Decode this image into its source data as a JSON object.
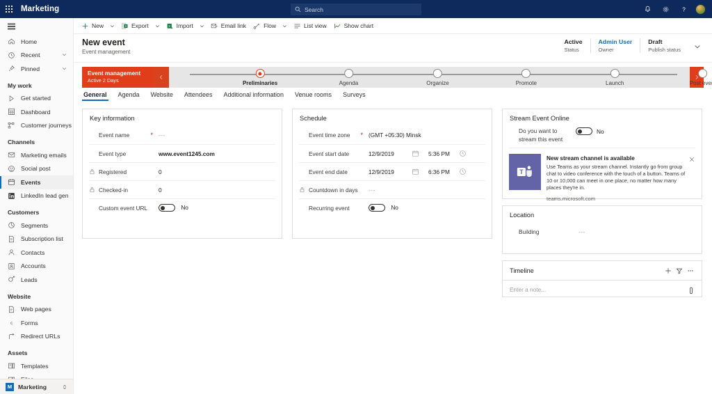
{
  "topbar": {
    "app_title": "Marketing",
    "waffle_name": "app-launcher",
    "search_placeholder": "Search",
    "icons": [
      "notification-bell-icon",
      "gear-icon",
      "help-question-icon",
      "user-avatar"
    ]
  },
  "commandbar": {
    "items": [
      {
        "label": "New",
        "icon": "plus-icon",
        "caret": true
      },
      {
        "label": "Export",
        "icon": "export-excel-icon",
        "caret": true
      },
      {
        "label": "Import",
        "icon": "import-excel-icon",
        "caret": true
      },
      {
        "label": "Email link",
        "icon": "email-link-icon",
        "caret": false
      },
      {
        "label": "Flow",
        "icon": "flow-icon",
        "caret": true
      },
      {
        "label": "List view",
        "icon": "list-view-icon",
        "caret": false
      },
      {
        "label": "Show chart",
        "icon": "show-chart-icon",
        "caret": false
      }
    ]
  },
  "sidebar": {
    "hamburger": "menu-icon",
    "top_items": [
      {
        "label": "Home",
        "icon": "home-icon",
        "chevron": false,
        "selected": false
      },
      {
        "label": "Recent",
        "icon": "clock-icon",
        "chevron": true,
        "selected": false
      },
      {
        "label": "Pinned",
        "icon": "pin-icon",
        "chevron": true,
        "selected": false
      }
    ],
    "groups": [
      {
        "title": "My work",
        "items": [
          {
            "label": "Get started",
            "icon": "play-icon",
            "selected": false
          },
          {
            "label": "Dashboard",
            "icon": "dashboard-icon",
            "selected": false
          },
          {
            "label": "Customer journeys",
            "icon": "journey-icon",
            "selected": false
          }
        ]
      },
      {
        "title": "Channels",
        "items": [
          {
            "label": "Marketing emails",
            "icon": "envelope-icon",
            "selected": false
          },
          {
            "label": "Social post",
            "icon": "social-icon",
            "selected": false
          },
          {
            "label": "Events",
            "icon": "calendar-icon",
            "selected": true
          },
          {
            "label": "LinkedIn lead gen",
            "icon": "linkedin-icon",
            "selected": false
          }
        ]
      },
      {
        "title": "Customers",
        "items": [
          {
            "label": "Segments",
            "icon": "segments-icon",
            "selected": false
          },
          {
            "label": "Subscription list",
            "icon": "subscription-icon",
            "selected": false
          },
          {
            "label": "Contacts",
            "icon": "contact-person-icon",
            "selected": false
          },
          {
            "label": "Accounts",
            "icon": "accounts-icon",
            "selected": false
          },
          {
            "label": "Leads",
            "icon": "leads-icon",
            "selected": false
          }
        ]
      },
      {
        "title": "Website",
        "items": [
          {
            "label": "Web pages",
            "icon": "webpage-icon",
            "selected": false
          },
          {
            "label": "Forms",
            "icon": "forms-icon",
            "selected": false
          },
          {
            "label": "Redirect URLs",
            "icon": "redirect-icon",
            "selected": false
          }
        ]
      },
      {
        "title": "Assets",
        "items": [
          {
            "label": "Templates",
            "icon": "templates-icon",
            "selected": false
          },
          {
            "label": "Files",
            "icon": "files-icon",
            "selected": false
          }
        ]
      }
    ],
    "footer": {
      "badge": "M",
      "label": "Marketing",
      "switcher_icon": "area-switcher-icon"
    }
  },
  "record_header": {
    "title": "New event",
    "subtitle": "Event management",
    "fields": [
      {
        "value": "Active",
        "label": "Status",
        "link": false
      },
      {
        "value": "Admin User",
        "label": "Owner",
        "link": true
      },
      {
        "value": "Draft",
        "label": "Publish status",
        "link": false
      }
    ],
    "expand_icon": "chevron-down-icon"
  },
  "bpf": {
    "active_process": "Event management",
    "active_duration": "Active 2 Days",
    "prev_icon": "chevron-left-icon",
    "next_icon": "chevron-right-icon",
    "stages": [
      {
        "label": "Preliminaries",
        "current": true
      },
      {
        "label": "Agenda",
        "current": false
      },
      {
        "label": "Organize",
        "current": false
      },
      {
        "label": "Promote",
        "current": false
      },
      {
        "label": "Launch",
        "current": false
      },
      {
        "label": "Post event",
        "current": false
      }
    ],
    "accent_color": "#e03e1a"
  },
  "tabs": [
    {
      "label": "General",
      "active": true
    },
    {
      "label": "Agenda",
      "active": false
    },
    {
      "label": "Website",
      "active": false
    },
    {
      "label": "Attendees",
      "active": false
    },
    {
      "label": "Additional information",
      "active": false
    },
    {
      "label": "Venue rooms",
      "active": false
    },
    {
      "label": "Surveys",
      "active": false
    }
  ],
  "key_information": {
    "title": "Key information",
    "rows": [
      {
        "label": "Event name",
        "required": true,
        "locked": false,
        "value": "---",
        "type": "placeholder"
      },
      {
        "label": "Event type",
        "required": false,
        "locked": false,
        "value": "www.event1245.com",
        "type": "bold"
      },
      {
        "label": "Registered",
        "required": false,
        "locked": true,
        "value": "0",
        "type": "text"
      },
      {
        "label": "Checked-in",
        "required": false,
        "locked": true,
        "value": "0",
        "type": "text"
      },
      {
        "label": "Custom event URL",
        "required": false,
        "locked": false,
        "value": "No",
        "type": "toggle",
        "toggle_on": false
      }
    ]
  },
  "schedule": {
    "title": "Schedule",
    "rows": [
      {
        "label": "Event time zone",
        "required": true,
        "locked": false,
        "value": "(GMT +05:30) Minsk",
        "type": "text"
      },
      {
        "label": "Event start date",
        "required": false,
        "locked": false,
        "value": "12/9/2019",
        "type": "datetime",
        "time": "5:36 PM",
        "date_icon": "calendar-icon",
        "time_icon": "clock-icon"
      },
      {
        "label": "Event end date",
        "required": false,
        "locked": false,
        "value": "12/9/2019",
        "type": "datetime",
        "time": "6:36 PM",
        "date_icon": "calendar-icon",
        "time_icon": "clock-icon"
      },
      {
        "label": "Countdown in days",
        "required": false,
        "locked": true,
        "value": "---",
        "type": "placeholder"
      },
      {
        "label": "Recurring event",
        "required": false,
        "locked": false,
        "value": "No",
        "type": "toggle",
        "toggle_on": false
      }
    ]
  },
  "stream_event_online": {
    "title": "Stream Event Online",
    "toggle_label": "Do you want to stream this event",
    "toggle_value": "No",
    "toggle_on": false,
    "banner": {
      "tile_icon": "microsoft-teams-icon",
      "tile_color": "#6264a7",
      "title": "New stream channel is available",
      "text": "Use Teams as your stream channel. Instantly go from group chat to video conference with the touch of a button. Teams of 10 or 10,000 can meet in one place, no matter how many places they're in.",
      "link": "teams.microsoft.com",
      "close_icon": "close-icon"
    }
  },
  "location": {
    "title": "Location",
    "rows": [
      {
        "label": "Building",
        "value": "---",
        "type": "placeholder"
      }
    ]
  },
  "timeline": {
    "title": "Timeline",
    "actions": [
      {
        "icon": "plus-icon",
        "name": "timeline-add-button"
      },
      {
        "icon": "filter-icon",
        "name": "timeline-filter-button"
      },
      {
        "icon": "more-ellipsis-icon",
        "name": "timeline-more-button"
      }
    ],
    "note_placeholder": "Enter a note...",
    "attach_icon": "paperclip-icon"
  }
}
